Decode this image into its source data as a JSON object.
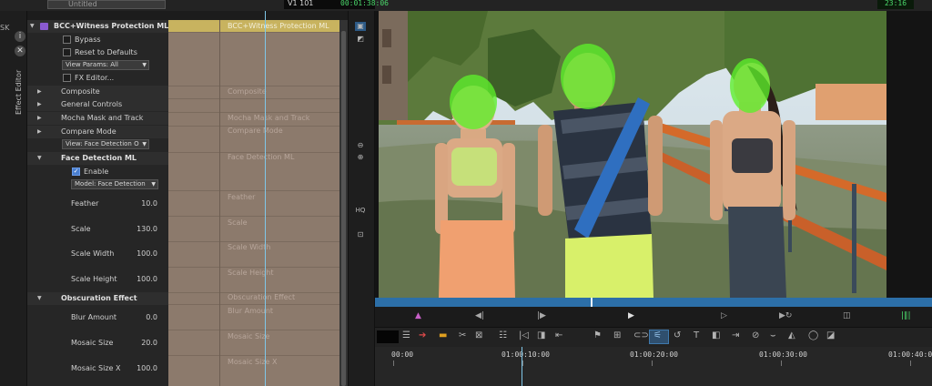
{
  "app": {
    "top_dropdown": "Untitled",
    "timecode_left": "V1  101",
    "timecode_green": "00:01:38:06",
    "timecode_right": "23:16"
  },
  "dock": {
    "partial_label": "SK",
    "effect_editor_tab": "Effect Editor"
  },
  "effect": {
    "name": "BCC+Witness Protection ML",
    "bypass": "Bypass",
    "reset": "Reset to Defaults",
    "view_params": "View Params: All",
    "fx_editor": "FX Editor...",
    "groups": {
      "composite": "Composite",
      "general": "General Controls",
      "mocha": "Mocha Mask and Track",
      "compare": "Compare Mode",
      "compare_view": "View: Face Detection O",
      "face": "Face Detection ML",
      "enable": "Enable",
      "model": "Model: Face Detection",
      "obscuration": "Obscuration Effect"
    },
    "params": [
      {
        "label": "Feather",
        "value": "10.0"
      },
      {
        "label": "Scale",
        "value": "130.0"
      },
      {
        "label": "Scale Width",
        "value": "100.0"
      },
      {
        "label": "Scale Height",
        "value": "100.0"
      },
      {
        "label": "Blur Amount",
        "value": "0.0"
      },
      {
        "label": "Mosaic Size",
        "value": "20.0"
      },
      {
        "label": "Mosaic Size X",
        "value": "100.0"
      }
    ]
  },
  "lanes": {
    "header": "BCC+Witness Protection ML",
    "labels": [
      "Composite",
      "Mocha Mask and Track",
      "Compare Mode",
      "Face Detection ML",
      "Feather",
      "Scale",
      "Scale Width",
      "Scale Height",
      "Obscuration Effect",
      "Blur Amount",
      "Mosaic Size",
      "Mosaic Size X"
    ]
  },
  "viewer_tools": [
    "HQ"
  ],
  "ruler": {
    "labels": [
      "00:00",
      "01:00:10:00",
      "01:00:20:00",
      "01:00:30:00",
      "01:00:40:00"
    ]
  },
  "colors": {
    "face_overlay": "#5cf02a",
    "keyframe_lane": "#8c7a6c",
    "header_lane": "#c8b35f",
    "scrub": "#2c6fa8",
    "accent_blue": "#4a7fd0"
  }
}
